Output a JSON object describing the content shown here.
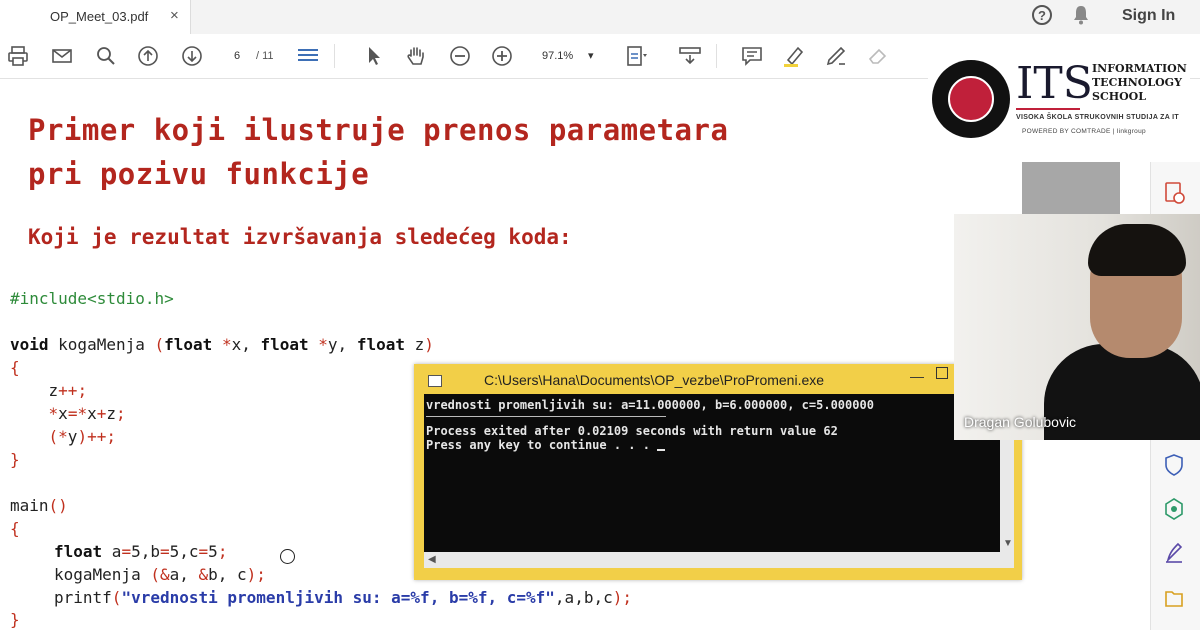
{
  "tab": {
    "label": "OP_Meet_03.pdf",
    "close": "×"
  },
  "header": {
    "sign_in": "Sign In",
    "help": "?"
  },
  "toolbar": {
    "page_current": "6",
    "page_total": "/ 11",
    "zoom": "97.1%",
    "zoom_caret": "▾"
  },
  "slide": {
    "title_line1": "Primer koji ilustruje prenos parametara",
    "title_line2": "pri pozivu funkcije",
    "subtitle": "Koji je rezultat izvršavanja sledećeg koda:"
  },
  "code": {
    "include": "#include<stdio.h>",
    "sig_void": "void",
    "sig_name": " kogaMenja ",
    "sig_open": "(",
    "sig_float1": "float",
    "sig_star1": " *",
    "sig_x": "x, ",
    "sig_float2": "float",
    "sig_star2": " *",
    "sig_y": "y, ",
    "sig_float3": "float",
    "sig_z": " z",
    "sig_close": ")",
    "brace_open": "{",
    "l1_a": "    z",
    "l1_b": "++;",
    "l2_a": "    *",
    "l2_b": "x",
    "l2_c": "=*",
    "l2_d": "x",
    "l2_e": "+",
    "l2_f": "z",
    "l2_g": ";",
    "l3_a": "    (*",
    "l3_b": "y",
    "l3_c": ")++;",
    "brace_close": "}",
    "main": "main",
    "main_parens": "()",
    "main_open": "{",
    "m1_float": "float",
    "m1_rest1": " a",
    "m1_eq1": "=",
    "m1_v1": "5",
    "m1_rest2": ",b",
    "m1_eq2": "=",
    "m1_v2": "5",
    "m1_rest3": ",c",
    "m1_eq3": "=",
    "m1_v3": "5",
    "m1_semi": ";",
    "m2_name": "kogaMenja ",
    "m2_open": "(&",
    "m2_a": "a, ",
    "m2_amp": "&",
    "m2_b": "b, c",
    "m2_close": ");",
    "m3_fn": "printf",
    "m3_open": "(",
    "m3_str": "\"vrednosti promenljivih su: a=%f, b=%f, c=%f\"",
    "m3_rest": ",a,b,c",
    "m3_close": ");",
    "main_close": "}"
  },
  "console": {
    "title": "C:\\Users\\Hana\\Documents\\OP_vezbe\\ProPromeni.exe",
    "line1": "vrednosti promenljivih su: a=11.000000, b=6.000000, c=5.000000",
    "line2": "Process exited after 0.02109 seconds with return value 62",
    "line3": "Press any key to continue . . . "
  },
  "logo": {
    "its": "ITS",
    "word1": "INFORMATION",
    "word2": "TECHNOLOGY",
    "word3": "SCHOOL",
    "sub": "VISOKA ŠKOLA STRUKOVNIH STUDIJA ZA IT",
    "powered": "POWERED BY  COMTRADE | linkgroup"
  },
  "webcam": {
    "name": "Dragan Golubovic"
  },
  "colors": {
    "title_red": "#b3261e",
    "console_frame": "#f2cf48",
    "code_green": "#2e8b3a",
    "code_string": "#2a3ca8"
  }
}
